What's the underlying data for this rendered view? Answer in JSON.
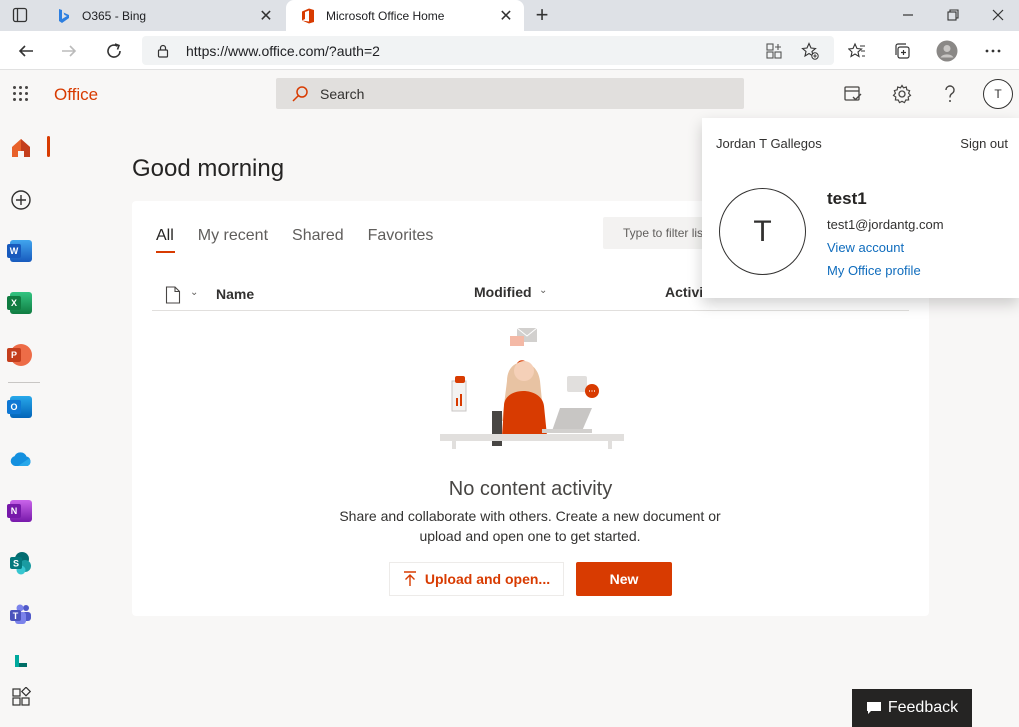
{
  "browser": {
    "tabs": [
      {
        "title": "O365 - Bing",
        "active": false
      },
      {
        "title": "Microsoft Office Home",
        "active": true
      }
    ],
    "url": "https://www.office.com/?auth=2"
  },
  "header": {
    "brand": "Office",
    "search_placeholder": "Search",
    "avatar_initial": "T"
  },
  "rail": {
    "apps": [
      "Home",
      "Create",
      "Word",
      "Excel",
      "PowerPoint",
      "Outlook",
      "OneDrive",
      "OneNote",
      "SharePoint",
      "Teams",
      "Bookings",
      "All apps"
    ]
  },
  "main": {
    "greeting": "Good morning",
    "tabs": [
      "All",
      "My recent",
      "Shared",
      "Favorites"
    ],
    "filter_placeholder": "Type to filter list",
    "columns": {
      "name": "Name",
      "modified": "Modified",
      "activity": "Activity"
    },
    "empty_title": "No content activity",
    "empty_desc": "Share and collaborate with others. Create a new document or upload and open one to get started.",
    "upload_label": "Upload and open...",
    "new_label": "New"
  },
  "account": {
    "display_name": "Jordan T Gallegos",
    "sign_out": "Sign out",
    "initial": "T",
    "username": "test1",
    "email": "test1@jordantg.com",
    "view_account": "View account",
    "profile": "My Office profile"
  },
  "feedback_label": "Feedback",
  "colors": {
    "accent": "#d83b01",
    "link": "#0f6cbd"
  }
}
